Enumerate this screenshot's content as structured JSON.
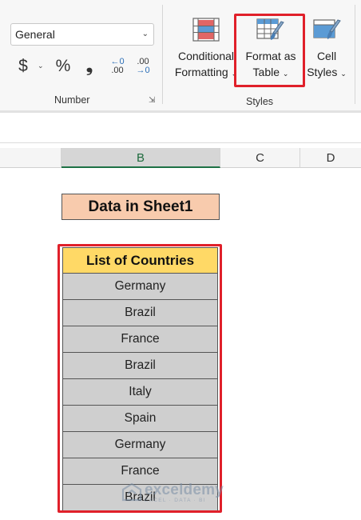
{
  "ribbon": {
    "number_group": {
      "format_value": "General",
      "currency_symbol": "$",
      "percent_symbol": "%",
      "comma_symbol": "❟",
      "increase_decimal": {
        "top": "←0",
        "bottom": ".00"
      },
      "decrease_decimal": {
        "top": ".00",
        "bottom": "→0"
      },
      "label": "Number"
    },
    "styles_group": {
      "conditional_formatting": {
        "line1": "Conditional",
        "line2": "Formatting"
      },
      "format_as_table": {
        "line1": "Format as",
        "line2": "Table"
      },
      "cell_styles": {
        "line1": "Cell",
        "line2": "Styles"
      },
      "label": "Styles"
    }
  },
  "grid": {
    "columns": [
      "B",
      "C",
      "D"
    ],
    "selected_column": "B",
    "title_cell": "Data in Sheet1",
    "table_header": "List of Countries",
    "rows": [
      "Germany",
      "Brazil",
      "France",
      "Brazil",
      "Italy",
      "Spain",
      "Germany",
      "France",
      "Brazil"
    ]
  },
  "watermark": {
    "name": "exceldemy",
    "tagline": "EXCEL · DATA · BI"
  },
  "colors": {
    "highlight": "#e0202a",
    "title_fill": "#f8cbad",
    "header_fill": "#ffd966",
    "row_fill": "#cfcfcf",
    "selected_column": "#1e7145"
  }
}
